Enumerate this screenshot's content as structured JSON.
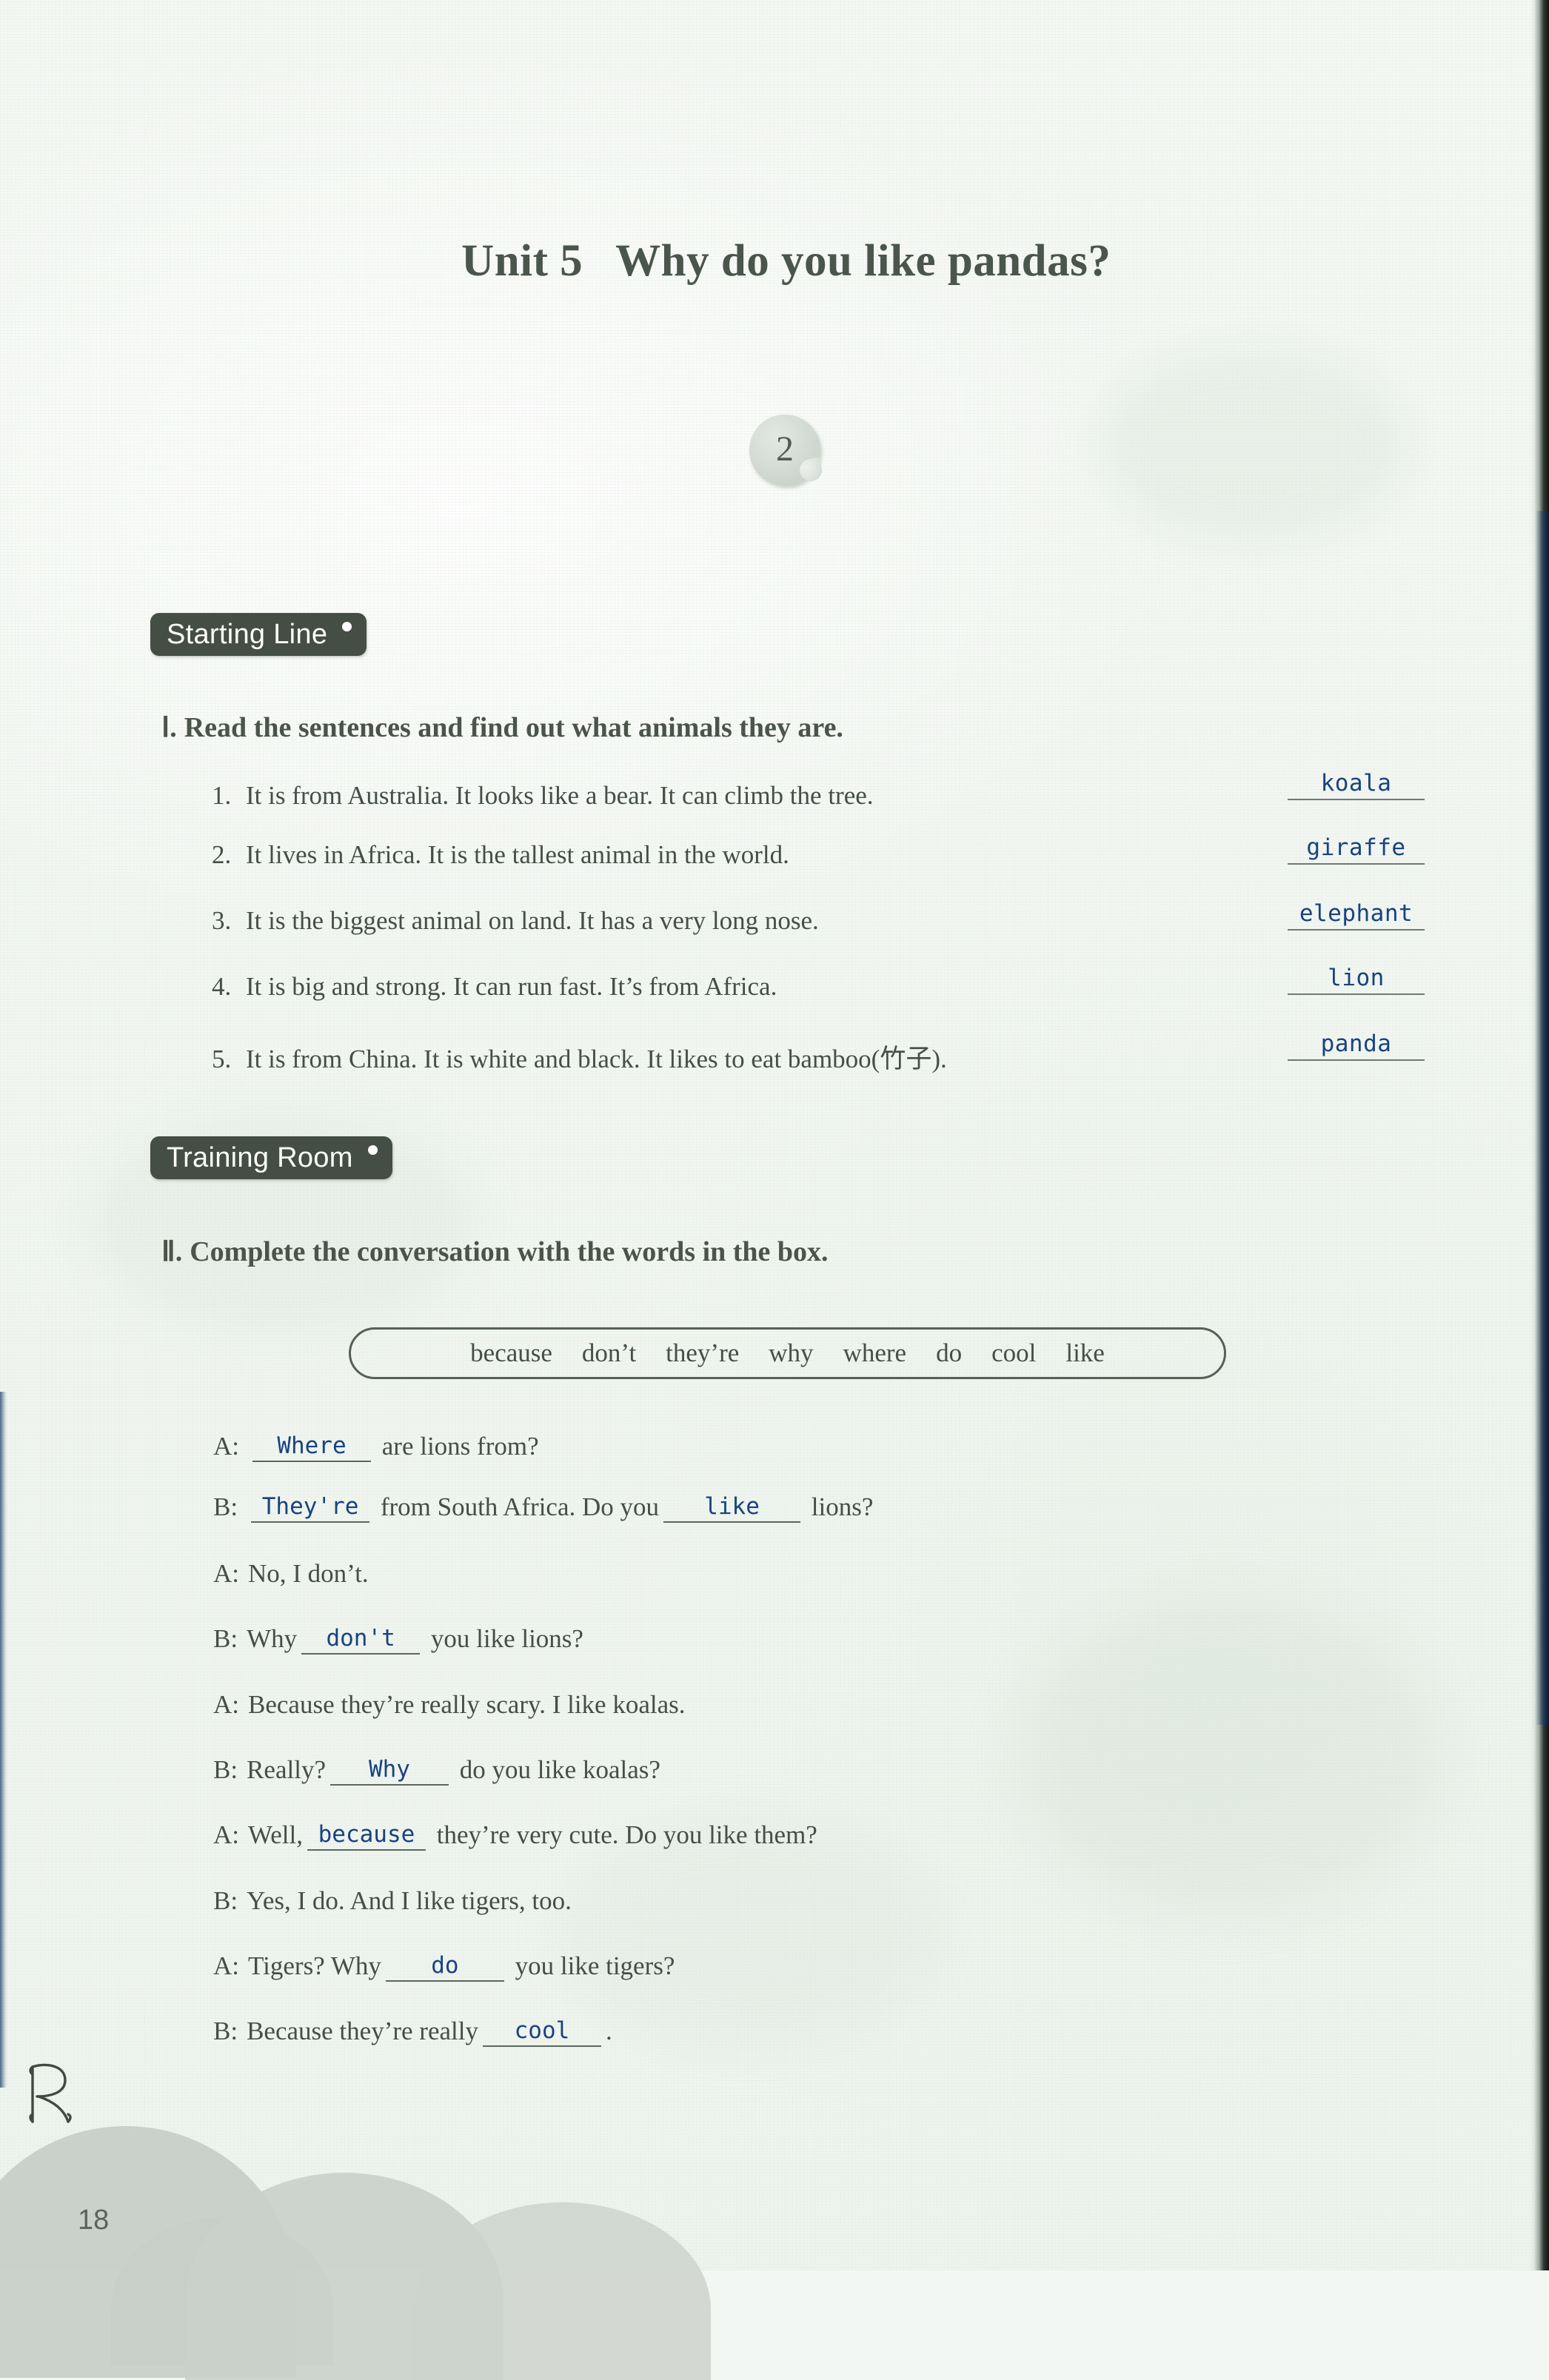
{
  "page": {
    "unit_label": "Unit 5",
    "unit_title": "Why do you like pandas?",
    "sticker_number": "2",
    "page_number": "18",
    "logo": "r-logo",
    "paper_color": "#f3f7f3",
    "ink_color": "#454e47",
    "handwriting_color": "#18437f",
    "tab_color": "#454e44"
  },
  "sections": [
    {
      "tab_label": "Starting Line",
      "heading_numeral": "Ⅰ.",
      "heading_text": "Read the sentences and find out what animals they are.",
      "items": [
        {
          "num": "1.",
          "text": "It is from Australia. It looks like a bear. It can climb the tree.",
          "answer": "koala"
        },
        {
          "num": "2.",
          "text": "It lives in Africa. It is the tallest animal in the world.",
          "answer": "giraffe"
        },
        {
          "num": "3.",
          "text": "It is the biggest animal on land. It has a very long nose.",
          "answer": "elephant"
        },
        {
          "num": "4.",
          "text": "It is big and strong. It can run fast. It’s from Africa.",
          "answer": "lion"
        },
        {
          "num": "5.",
          "text": "It is from China. It is white and black. It likes to eat bamboo(竹子).",
          "answer": "panda"
        }
      ]
    },
    {
      "tab_label": "Training Room",
      "heading_numeral": "Ⅱ.",
      "heading_text": "Complete the conversation with the words in the box.",
      "word_bank": [
        "because",
        "don’t",
        "they’re",
        "why",
        "where",
        "do",
        "cool",
        "like"
      ],
      "conversation": [
        {
          "speaker": "A:",
          "parts": [
            {
              "type": "blank",
              "value": "Where",
              "size": "md"
            },
            {
              "type": "text",
              "value": " are lions from?"
            }
          ]
        },
        {
          "speaker": "B:",
          "parts": [
            {
              "type": "blank",
              "value": "They're",
              "size": "md"
            },
            {
              "type": "text",
              "value": " from South Africa. Do you"
            },
            {
              "type": "blank",
              "value": "like",
              "size": "lg"
            },
            {
              "type": "text",
              "value": " lions?"
            }
          ]
        },
        {
          "speaker": "A:",
          "parts": [
            {
              "type": "text",
              "value": "No, I don’t."
            }
          ]
        },
        {
          "speaker": "B:",
          "parts": [
            {
              "type": "text",
              "value": "Why"
            },
            {
              "type": "blank",
              "value": "don't",
              "size": "md"
            },
            {
              "type": "text",
              "value": " you like lions?"
            }
          ]
        },
        {
          "speaker": "A:",
          "parts": [
            {
              "type": "text",
              "value": "Because they’re really scary. I like koalas."
            }
          ]
        },
        {
          "speaker": "B:",
          "parts": [
            {
              "type": "text",
              "value": "Really?"
            },
            {
              "type": "blank",
              "value": "Why",
              "size": "md"
            },
            {
              "type": "text",
              "value": " do you like koalas?"
            }
          ]
        },
        {
          "speaker": "A:",
          "parts": [
            {
              "type": "text",
              "value": "Well,"
            },
            {
              "type": "blank",
              "value": "because",
              "size": "md"
            },
            {
              "type": "text",
              "value": " they’re very cute. Do you like them?"
            }
          ]
        },
        {
          "speaker": "B:",
          "parts": [
            {
              "type": "text",
              "value": "Yes, I do. And I like tigers, too."
            }
          ]
        },
        {
          "speaker": "A:",
          "parts": [
            {
              "type": "text",
              "value": "Tigers? Why"
            },
            {
              "type": "blank",
              "value": "do",
              "size": "md"
            },
            {
              "type": "text",
              "value": " you like tigers?"
            }
          ]
        },
        {
          "speaker": "B:",
          "parts": [
            {
              "type": "text",
              "value": "Because they’re really"
            },
            {
              "type": "blank",
              "value": "cool",
              "size": "md"
            },
            {
              "type": "text",
              "value": "."
            }
          ]
        }
      ]
    }
  ]
}
